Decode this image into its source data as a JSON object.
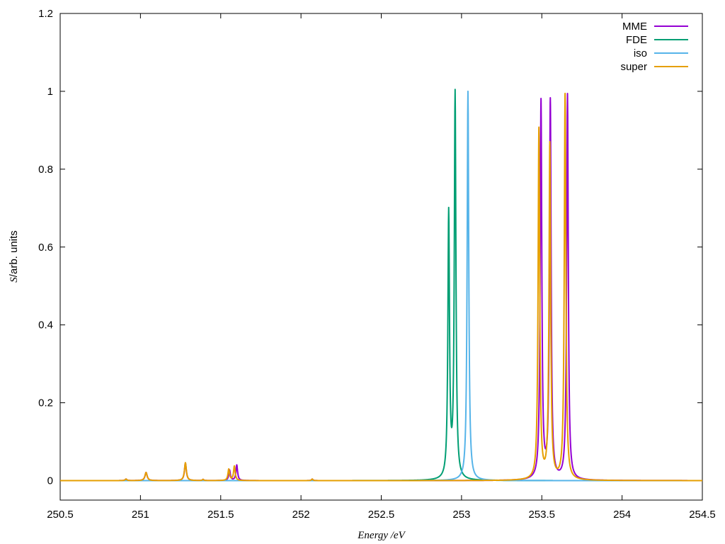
{
  "chart_data": {
    "type": "line",
    "title": "",
    "xlabel": "Energy /eV",
    "ylabel": "S/arb. units",
    "ylabel_italic_part": "S",
    "ylabel_rest": "/arb. units",
    "xlim": [
      250.5,
      254.5
    ],
    "ylim": [
      -0.05,
      1.2
    ],
    "xticks": [
      250.5,
      251,
      251.5,
      252,
      252.5,
      253,
      253.5,
      254,
      254.5
    ],
    "xtick_labels": [
      "250.5",
      "251",
      "251.5",
      "252",
      "252.5",
      "253",
      "253.5",
      "254",
      "254.5"
    ],
    "yticks": [
      0,
      0.2,
      0.4,
      0.6,
      0.8,
      1,
      1.2
    ],
    "ytick_labels": [
      "0",
      "0.2",
      "0.4",
      "0.6",
      "0.8",
      "1",
      "1.2"
    ],
    "grid": false,
    "legend_position": "top-right",
    "series": [
      {
        "name": "MME",
        "color": "#9400d3",
        "peaks": [
          {
            "x": 250.91,
            "amp": 0.004,
            "gamma": 0.006
          },
          {
            "x": 251.035,
            "amp": 0.021,
            "gamma": 0.008
          },
          {
            "x": 251.28,
            "amp": 0.045,
            "gamma": 0.007
          },
          {
            "x": 251.39,
            "amp": 0.003,
            "gamma": 0.005
          },
          {
            "x": 251.555,
            "amp": 0.027,
            "gamma": 0.006
          },
          {
            "x": 251.6,
            "amp": 0.04,
            "gamma": 0.006
          },
          {
            "x": 252.07,
            "amp": 0.004,
            "gamma": 0.005
          },
          {
            "x": 253.495,
            "amp": 0.97,
            "gamma": 0.006
          },
          {
            "x": 253.553,
            "amp": 0.97,
            "gamma": 0.006
          },
          {
            "x": 253.66,
            "amp": 0.99,
            "gamma": 0.006
          }
        ]
      },
      {
        "name": "FDE",
        "color": "#009e73",
        "peaks": [
          {
            "x": 252.92,
            "amp": 0.68,
            "gamma": 0.006
          },
          {
            "x": 252.96,
            "amp": 0.99,
            "gamma": 0.006
          }
        ]
      },
      {
        "name": "iso",
        "color": "#56b4e9",
        "peaks": [
          {
            "x": 253.04,
            "amp": 1.0,
            "gamma": 0.006
          }
        ]
      },
      {
        "name": "super",
        "color": "#e69f00",
        "peaks": [
          {
            "x": 250.91,
            "amp": 0.004,
            "gamma": 0.006
          },
          {
            "x": 251.035,
            "amp": 0.021,
            "gamma": 0.008
          },
          {
            "x": 251.28,
            "amp": 0.046,
            "gamma": 0.007
          },
          {
            "x": 251.39,
            "amp": 0.003,
            "gamma": 0.005
          },
          {
            "x": 251.55,
            "amp": 0.029,
            "gamma": 0.006
          },
          {
            "x": 251.585,
            "amp": 0.037,
            "gamma": 0.006
          },
          {
            "x": 252.07,
            "amp": 0.004,
            "gamma": 0.005
          },
          {
            "x": 253.482,
            "amp": 0.9,
            "gamma": 0.006
          },
          {
            "x": 253.55,
            "amp": 0.86,
            "gamma": 0.006
          },
          {
            "x": 253.645,
            "amp": 0.99,
            "gamma": 0.006
          }
        ]
      }
    ]
  }
}
